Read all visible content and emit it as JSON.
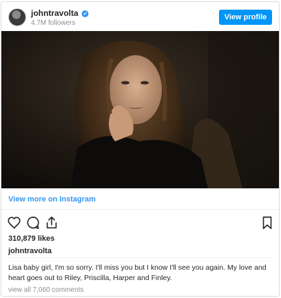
{
  "post": {
    "username": "johntravolta",
    "followers": "4.7M followers",
    "view_profile_label": "View profile",
    "view_more_label": "View more on Instagram",
    "likes": "310,879 likes",
    "caption_author": "johntravolta",
    "caption": "Lisa baby girl, I'm so sorry. I'll miss you but I know I'll see you again. My love and heart goes out to Riley, Priscilla, Harper and Finley.",
    "comments_link": "view all 7,060 comments"
  },
  "icons": {
    "verified": "verified-badge-icon",
    "like": "heart-icon",
    "comment": "comment-icon",
    "share": "share-icon",
    "save": "bookmark-icon"
  },
  "colors": {
    "accent": "#0095f6",
    "link": "#3897f0",
    "secondary_text": "#8e8e8e",
    "border": "#dbdbdb"
  }
}
